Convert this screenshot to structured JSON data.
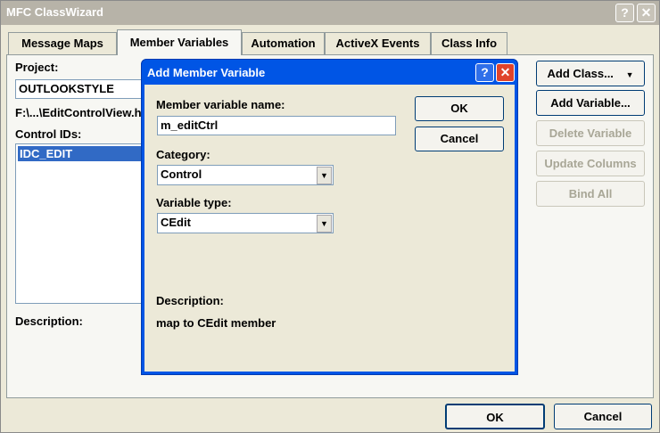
{
  "window": {
    "title": "MFC ClassWizard",
    "help_btn": "?",
    "close_btn": "✕"
  },
  "tabs": [
    {
      "label": "Message Maps"
    },
    {
      "label": "Member Variables"
    },
    {
      "label": "Automation"
    },
    {
      "label": "ActiveX Events"
    },
    {
      "label": "Class Info"
    }
  ],
  "main": {
    "project_label": "Project:",
    "project_value": "OUTLOOKSTYLE",
    "file_path": "F:\\...\\EditControlView.h",
    "control_ids_label": "Control IDs:",
    "control_ids": [
      "IDC_EDIT"
    ],
    "description_label": "Description:"
  },
  "side_buttons": {
    "add_class": "Add Class...",
    "add_class_arrow": "▼",
    "add_variable": "Add Variable...",
    "delete_variable": "Delete Variable",
    "update_columns": "Update Columns",
    "bind_all": "Bind All"
  },
  "footer": {
    "ok": "OK",
    "cancel": "Cancel"
  },
  "dialog": {
    "title": "Add Member Variable",
    "help_btn": "?",
    "close_btn": "✕",
    "name_label": "Member variable name:",
    "name_value": "m_editCtrl",
    "category_label": "Category:",
    "category_value": "Control",
    "type_label": "Variable type:",
    "type_value": "CEdit",
    "combo_arrow": "▼",
    "ok": "OK",
    "cancel": "Cancel",
    "description_label": "Description:",
    "description_text": "map to CEdit member"
  },
  "colors": {
    "selection": "#316ac5",
    "dialog_title": "#0055e5",
    "close_red": "#e0442b"
  }
}
